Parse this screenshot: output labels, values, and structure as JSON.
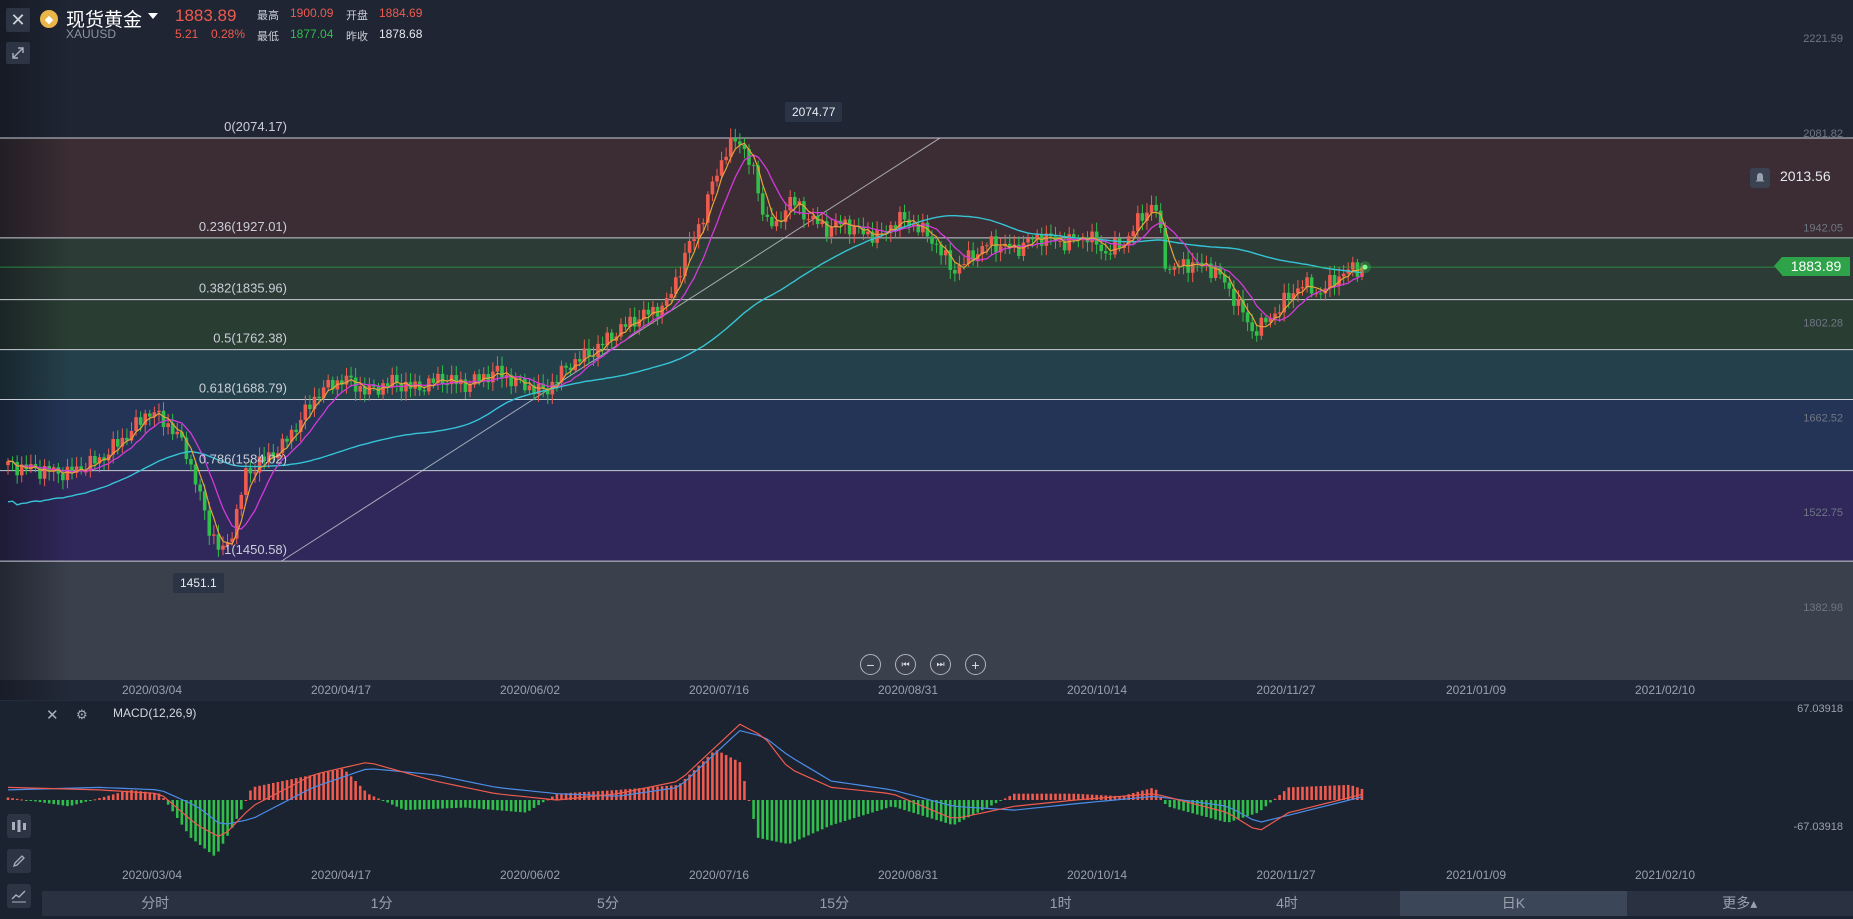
{
  "header": {
    "coin_icon": "gold-coin-icon",
    "title": "现货黄金",
    "code": "XAUUSD",
    "price": "1883.89",
    "change": "5.21",
    "change_pct": "0.28%",
    "high_label": "最高",
    "high": "1900.09",
    "open_label": "开盘",
    "open": "1884.69",
    "low_label": "最低",
    "low": "1877.04",
    "prev_label": "昨收",
    "prev_close": "1878.68"
  },
  "colors": {
    "up": "#ef5b4e",
    "down": "#2fbf4a",
    "ma_orange": "#e8a33a",
    "ma_purple": "#d33ad8",
    "ma_cyan": "#36c3d6",
    "macd_blue": "#4c8de8",
    "macd_red": "#ef5b4e"
  },
  "icons": {
    "close": "close-icon",
    "expand": "expand-icon",
    "bell": "bell-icon",
    "settings": "settings-icon",
    "zoom_out": "minus-icon",
    "scroll_start": "skip-back-icon",
    "scroll_end": "skip-forward-icon",
    "zoom_in": "plus-icon",
    "indicators": "indicators-icon",
    "draw": "pencil-icon",
    "trend": "trend-icon"
  },
  "chart_data": [
    {
      "type": "candlestick",
      "title": "",
      "price_axis_ticks": [
        "2221.59",
        "2081.82",
        "1942.05",
        "1802.28",
        "1662.52",
        "1522.75",
        "1382.98"
      ],
      "date_ticks": [
        "2020/03/04",
        "2020/04/17",
        "2020/06/02",
        "2020/07/16",
        "2020/08/31",
        "2020/10/14",
        "2020/11/27",
        "2021/01/09",
        "2021/02/10"
      ],
      "ylim": [
        1382.98,
        2221.59
      ],
      "current_price": "1883.89",
      "alert_price": "2013.56",
      "marked_high": "2074.77",
      "marked_low": "1451.1",
      "fibonacci": [
        {
          "label": "0(2074.17)",
          "value": 2074.17
        },
        {
          "label": "0.236(1927.01)",
          "value": 1927.01
        },
        {
          "label": "0.382(1835.96)",
          "value": 1835.96
        },
        {
          "label": "0.5(1762.38)",
          "value": 1762.38
        },
        {
          "label": "0.618(1688.79)",
          "value": 1688.79
        },
        {
          "label": "0.786(1584.02)",
          "value": 1584.02
        },
        {
          "label": "1(1450.58)",
          "value": 1450.58
        }
      ],
      "price_path": [
        [
          0,
          1592
        ],
        [
          10,
          1585
        ],
        [
          20,
          1580
        ],
        [
          30,
          1600
        ],
        [
          40,
          1640
        ],
        [
          46,
          1672
        ],
        [
          52,
          1655
        ],
        [
          58,
          1620
        ],
        [
          62,
          1560
        ],
        [
          66,
          1500
        ],
        [
          70,
          1460
        ],
        [
          74,
          1500
        ],
        [
          78,
          1580
        ],
        [
          84,
          1600
        ],
        [
          90,
          1620
        ],
        [
          96,
          1660
        ],
        [
          102,
          1700
        ],
        [
          110,
          1720
        ],
        [
          118,
          1700
        ],
        [
          126,
          1715
        ],
        [
          134,
          1705
        ],
        [
          142,
          1720
        ],
        [
          150,
          1710
        ],
        [
          160,
          1730
        ],
        [
          168,
          1712
        ],
        [
          176,
          1700
        ],
        [
          184,
          1740
        ],
        [
          192,
          1760
        ],
        [
          200,
          1790
        ],
        [
          206,
          1808
        ],
        [
          212,
          1820
        ],
        [
          216,
          1830
        ],
        [
          222,
          1900
        ],
        [
          228,
          1960
        ],
        [
          232,
          2020
        ],
        [
          236,
          2060
        ],
        [
          240,
          2072
        ],
        [
          244,
          2030
        ],
        [
          248,
          1960
        ],
        [
          252,
          1940
        ],
        [
          256,
          1985
        ],
        [
          262,
          1960
        ],
        [
          268,
          1940
        ],
        [
          274,
          1950
        ],
        [
          280,
          1935
        ],
        [
          286,
          1930
        ],
        [
          292,
          1955
        ],
        [
          298,
          1945
        ],
        [
          304,
          1920
        ],
        [
          310,
          1878
        ],
        [
          316,
          1900
        ],
        [
          322,
          1920
        ],
        [
          330,
          1910
        ],
        [
          338,
          1930
        ],
        [
          346,
          1920
        ],
        [
          354,
          1930
        ],
        [
          360,
          1905
        ],
        [
          366,
          1920
        ],
        [
          372,
          1960
        ],
        [
          376,
          1980
        ],
        [
          380,
          1880
        ],
        [
          388,
          1890
        ],
        [
          396,
          1880
        ],
        [
          402,
          1840
        ],
        [
          408,
          1790
        ],
        [
          412,
          1800
        ],
        [
          418,
          1830
        ],
        [
          424,
          1860
        ],
        [
          430,
          1845
        ],
        [
          436,
          1870
        ],
        [
          440,
          1880
        ],
        [
          445,
          1884
        ]
      ]
    },
    {
      "type": "macd",
      "title": "MACD(12,26,9)",
      "ylim": [
        -67.03918,
        67.03918
      ],
      "axis_ticks": [
        "67.03918",
        "-67.03918"
      ],
      "date_ticks": [
        "2020/03/04",
        "2020/04/17",
        "2020/06/02",
        "2020/07/16",
        "2020/08/31",
        "2020/10/14",
        "2020/11/27",
        "2021/01/09",
        "2021/02/10"
      ],
      "hist": [
        [
          0,
          2
        ],
        [
          20,
          -5
        ],
        [
          40,
          8
        ],
        [
          50,
          5
        ],
        [
          60,
          -30
        ],
        [
          68,
          -45
        ],
        [
          74,
          -20
        ],
        [
          80,
          10
        ],
        [
          100,
          20
        ],
        [
          110,
          25
        ],
        [
          118,
          5
        ],
        [
          130,
          -8
        ],
        [
          150,
          -6
        ],
        [
          170,
          -10
        ],
        [
          180,
          5
        ],
        [
          200,
          8
        ],
        [
          220,
          12
        ],
        [
          232,
          40
        ],
        [
          240,
          30
        ],
        [
          246,
          -30
        ],
        [
          256,
          -35
        ],
        [
          270,
          -20
        ],
        [
          290,
          -5
        ],
        [
          310,
          -20
        ],
        [
          330,
          5
        ],
        [
          350,
          5
        ],
        [
          365,
          3
        ],
        [
          376,
          10
        ],
        [
          380,
          -5
        ],
        [
          400,
          -18
        ],
        [
          410,
          -10
        ],
        [
          420,
          10
        ],
        [
          440,
          12
        ],
        [
          445,
          8
        ]
      ],
      "dif": [
        [
          0,
          10
        ],
        [
          30,
          8
        ],
        [
          50,
          5
        ],
        [
          62,
          -20
        ],
        [
          70,
          -30
        ],
        [
          80,
          -5
        ],
        [
          100,
          20
        ],
        [
          118,
          30
        ],
        [
          140,
          15
        ],
        [
          160,
          5
        ],
        [
          180,
          0
        ],
        [
          200,
          5
        ],
        [
          220,
          15
        ],
        [
          240,
          60
        ],
        [
          248,
          50
        ],
        [
          256,
          25
        ],
        [
          270,
          10
        ],
        [
          290,
          5
        ],
        [
          310,
          -15
        ],
        [
          330,
          -5
        ],
        [
          350,
          0
        ],
        [
          376,
          5
        ],
        [
          400,
          -10
        ],
        [
          410,
          -25
        ],
        [
          420,
          -10
        ],
        [
          445,
          5
        ]
      ],
      "dea": [
        [
          0,
          8
        ],
        [
          30,
          10
        ],
        [
          50,
          8
        ],
        [
          62,
          -5
        ],
        [
          70,
          -20
        ],
        [
          80,
          -15
        ],
        [
          100,
          10
        ],
        [
          118,
          25
        ],
        [
          140,
          20
        ],
        [
          160,
          10
        ],
        [
          180,
          5
        ],
        [
          200,
          3
        ],
        [
          220,
          10
        ],
        [
          240,
          55
        ],
        [
          248,
          50
        ],
        [
          256,
          35
        ],
        [
          270,
          15
        ],
        [
          290,
          8
        ],
        [
          310,
          -5
        ],
        [
          330,
          -8
        ],
        [
          350,
          -3
        ],
        [
          376,
          3
        ],
        [
          400,
          -5
        ],
        [
          410,
          -18
        ],
        [
          420,
          -12
        ],
        [
          445,
          3
        ]
      ]
    }
  ],
  "nav_buttons": [
    "zoom-out",
    "scroll-start",
    "scroll-end",
    "zoom-in"
  ],
  "timeframes": [
    {
      "label": "分时",
      "active": false
    },
    {
      "label": "1分",
      "active": false
    },
    {
      "label": "5分",
      "active": false
    },
    {
      "label": "15分",
      "active": false
    },
    {
      "label": "1时",
      "active": false
    },
    {
      "label": "4时",
      "active": false
    },
    {
      "label": "日K",
      "active": true
    },
    {
      "label": "更多▴",
      "active": false
    }
  ]
}
